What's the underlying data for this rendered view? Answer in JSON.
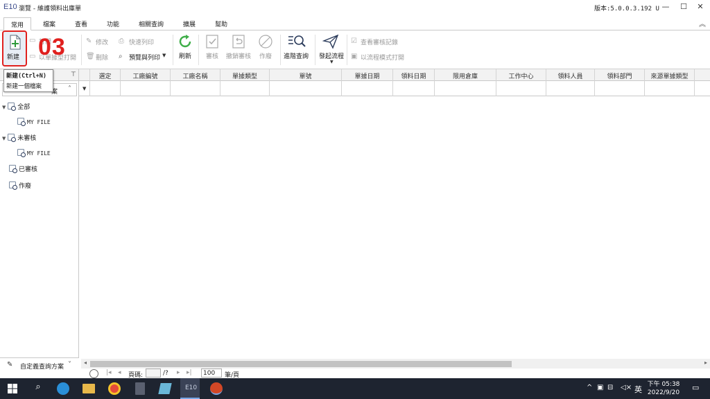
{
  "window": {
    "app_logo": "E10",
    "title": "瀏覽 - 維護領料出庫單",
    "version": "版本:5.0.0.3.192 U"
  },
  "ribbon_tabs": [
    "常用",
    "檔案",
    "查看",
    "功能",
    "相關查詢",
    "擴展",
    "幫助"
  ],
  "toolbar": {
    "new": "新建",
    "open": "打開",
    "open_list": "以單據型打開",
    "edit": "修改",
    "delete": "刪除",
    "quick_print": "快速列印",
    "preview_print": "預覽與列印",
    "refresh": "刷新",
    "approve": "審核",
    "unapprove": "撤銷審核",
    "void": "作廢",
    "advanced_query": "進階查詢",
    "start_flow": "發起流程",
    "view_audit_log": "查看審核記錄",
    "open_flow_mode": "以流程模式打開"
  },
  "annotation": "03",
  "tooltip": {
    "title": "新建(Ctrl+N)",
    "desc": "新建一個檔案"
  },
  "left_panel": {
    "header_suffix": "案",
    "tree": [
      {
        "label": "全部",
        "children": [
          "MY FILE"
        ]
      },
      {
        "label": "未審核",
        "children": [
          "MY FILE"
        ]
      },
      {
        "label": "已審核",
        "children": []
      },
      {
        "label": "作廢",
        "children": []
      }
    ],
    "custom_query": "自定義查詢方案"
  },
  "grid": {
    "columns": [
      "選定",
      "工廠編號",
      "工廠名稱",
      "單據類型",
      "單號",
      "單據日期",
      "領料日期",
      "限用倉庫",
      "工作中心",
      "領料人員",
      "領料部門",
      "來源單據類型"
    ]
  },
  "pager": {
    "page_label": "頁碼:",
    "page_total": "/?",
    "page_size": "100",
    "per_page_label": "筆/頁"
  },
  "taskbar": {
    "ime": "英",
    "time": "下午 05:38",
    "date": "2022/9/20"
  },
  "colors": {
    "annotation_red": "#e0201e",
    "refresh_green": "#3fae49",
    "new_green": "#2e9a3a",
    "taskbar_bg": "#1e2430"
  }
}
